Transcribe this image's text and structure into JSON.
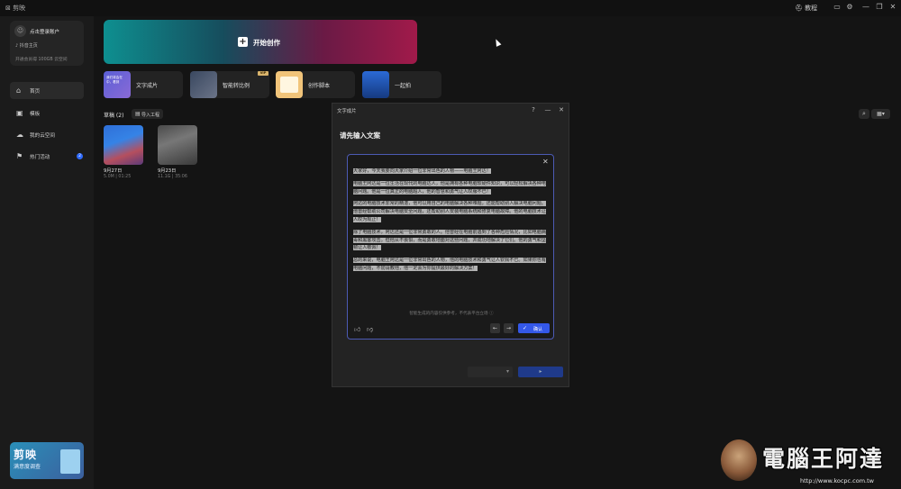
{
  "window": {
    "app_title": "剪映",
    "help_label": "教程"
  },
  "sidebar": {
    "account": {
      "login_text": "点击登录账户",
      "douyin_link": "抖音主页",
      "member_promo": "开通会员得 100GB 云空间"
    },
    "nav": [
      {
        "label": "首页",
        "icon": "home-icon"
      },
      {
        "label": "模板",
        "icon": "template-icon"
      },
      {
        "label": "我的云空间",
        "icon": "cloud-icon"
      },
      {
        "label": "热门活动",
        "icon": "flag-icon",
        "badge": "2"
      }
    ],
    "survey_banner": {
      "title": "剪映",
      "subtitle": "满意度调查"
    }
  },
  "main": {
    "start_label": "开始创作",
    "tools": [
      {
        "label": "文字成片",
        "thumb_text": "我们将会在中，看到"
      },
      {
        "label": "智能转比例",
        "badge": "VIP"
      },
      {
        "label": "创作脚本"
      },
      {
        "label": "一起拍"
      }
    ],
    "drafts": {
      "label": "草稿 (2)",
      "import_label": "导入工程",
      "items": [
        {
          "date": "9月27日",
          "meta": "5.0M | 01:25"
        },
        {
          "date": "9月23日",
          "meta": "11.1G | 35:06"
        }
      ]
    }
  },
  "dialog": {
    "title": "文字成片",
    "heading": "请先输入文案",
    "paragraphs": [
      "大家好，今天我要向大家介绍一位非常出色的人物——电脑王阿达！",
      "电脑王阿达是一位生活在现代的电脑达人，他是拥有各种电脑软硬件知识，可以轻松解决各种电脑问题。他是一位真正的电脑超人，他的智慧和勇气让人叹服不已！",
      "阿达的电脑技术非常的精湛，他可以用自己的电脑解决各种难题，还能帮助别人解决电脑问题。他曾经帮助公司解决电脑安全问题，还帮助别人安装电脑系统和修复电脑故障。他的电脑技术让人叹为观止！",
      "除了电脑技术，阿达还是一位非常勇敢的人。他曾经在电脑前遇到了各种危险情况，比如电脑病毒和黑客攻击。但他从不畏惧，而是勇敢地面对这些问题，并成功地解决了它们。他的勇气和坚韧让人敬佩！",
      "总的来说，电脑王阿达是一位非常出色的人物，他的电脑技术和勇气让人钦佩不已。如果你也有电脑问题，不妨请教他，他一定会为你提供最好的解决方案！"
    ],
    "ai_notice": "智能生成的内容仅供参考，不代表平台立场 ⓘ",
    "confirm_label": "确认"
  },
  "watermark": {
    "title": "電腦王阿達",
    "url": "http://www.kocpc.com.tw"
  }
}
